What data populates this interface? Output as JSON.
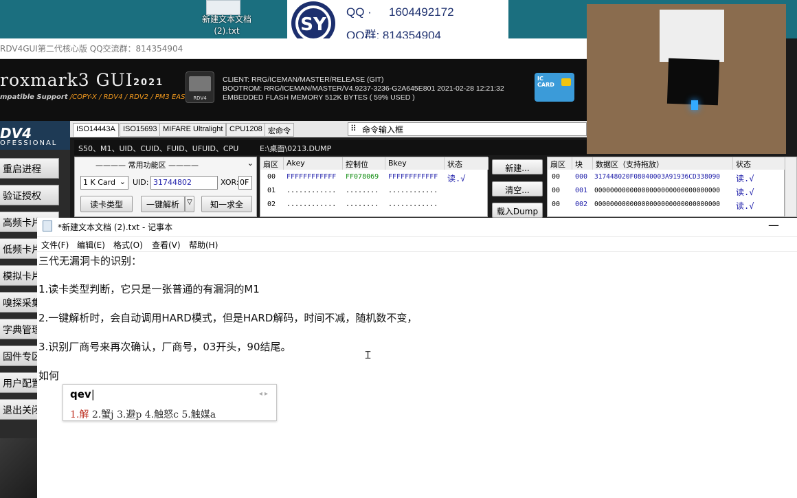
{
  "desktop": {
    "file_label_1": "新建文本文档",
    "file_label_2": "(2).txt",
    "logo_text": "SY",
    "qq_label": "QQ ·",
    "qq_number": "1604492172",
    "qq_group": "QQ群:  814354904"
  },
  "gui": {
    "window_title": "RDV4GUI第二代核心版 QQ交流群：814354904",
    "brand": "roxmark3 GUI",
    "brand_year": "2021",
    "brand_sub_prefix": "mpatible Support",
    "brand_sub_list": "/COPY-X / RDV4 / RDV2 / PM3 EASY",
    "device_label": "RDV4",
    "client": "CLIENT: RRG/ICEMAN/MASTER/RELEASE (GIT)",
    "bootrom": "BOOTROM: RRG/ICEMAN/MASTER/V4.9237-3236-G2A645E801 2021-02-28 12:21:32",
    "flash": "EMBEDDED FLASH MEMORY 512K BYTES ( 59% USED )",
    "ic_card": "IC CARD",
    "side_head_1": "DV4",
    "side_head_2": "OFESSIONAL",
    "side_buttons": [
      "重启进程",
      "验证授权",
      "高频卡片",
      "低频卡片",
      "模拟卡片",
      "嗅探采集",
      "字典管理",
      "固件专区",
      "用户配置",
      "退出关闭"
    ],
    "tabs": [
      "ISO14443A",
      "ISO15693",
      "MIFARE Ultralight",
      "CPU1208",
      "宏命令"
    ],
    "cmd_label": "命令输入框",
    "info_types": "S50、M1、UID、CUID、FUID、UFUID、CPU",
    "info_path": "E:\\桌面\\0213.DUMP",
    "func_title": "———— 常用功能区 ————",
    "card_type": "1 K Card",
    "uid_label": "UID:",
    "uid_value": "31744802",
    "xor_label": "XOR:",
    "xor_value": "0F",
    "btn_read_type": "读卡类型",
    "btn_one_key": "一键解析",
    "btn_know_all": "知一求全",
    "sector_headers": [
      "扇区",
      "Akey",
      "控制位",
      "Bkey",
      "状态"
    ],
    "sector_rows": [
      {
        "sector": "00",
        "akey": "FFFFFFFFFFFF",
        "ctrl": "FF078069",
        "bkey": "FFFFFFFFFFFF",
        "status": "读.√"
      },
      {
        "sector": "01",
        "akey": "............",
        "ctrl": "........",
        "bkey": "............",
        "status": ""
      },
      {
        "sector": "02",
        "akey": "............",
        "ctrl": "........",
        "bkey": "............",
        "status": ""
      }
    ],
    "btn_new": "新建...",
    "btn_clear": "清空...",
    "btn_load": "载入Dump",
    "block_headers": [
      "扇区",
      "块",
      "数据区（支持拖放）",
      "状态"
    ],
    "block_rows": [
      {
        "sector": "00",
        "block": "000",
        "data": "317448020F08040003A91936CD338090",
        "status": "读.√"
      },
      {
        "sector": "00",
        "block": "001",
        "data": "00000000000000000000000000000000",
        "status": "读.√"
      },
      {
        "sector": "00",
        "block": "002",
        "data": "00000000000000000000000000000000",
        "status": "读.√"
      }
    ]
  },
  "notepad": {
    "title": "*新建文本文档 (2).txt - 记事本",
    "menu": [
      "文件(F)",
      "编辑(E)",
      "格式(O)",
      "查看(V)",
      "帮助(H)"
    ],
    "lines": [
      "三代无漏洞卡的识别：",
      "1.读卡类型判断，它只是一张普通的有漏洞的M1",
      "2.一键解析时，会自动调用HARD模式，但是HARD解码，时间不减，随机数不变，",
      "3.识别厂商号来再次确认，厂商号，03开头，90结尾。",
      "如何"
    ]
  },
  "ime": {
    "input": "qev",
    "candidates_first": "1.解",
    "candidates_rest": "2.蟹j 3.避p 4.触怒c 5.触媒a"
  },
  "colors": {
    "accent_orange": "#f39a1e",
    "key_blue": "#1a1aa8",
    "ctrl_green": "#0a8a0a",
    "ime_red": "#c0392b"
  }
}
